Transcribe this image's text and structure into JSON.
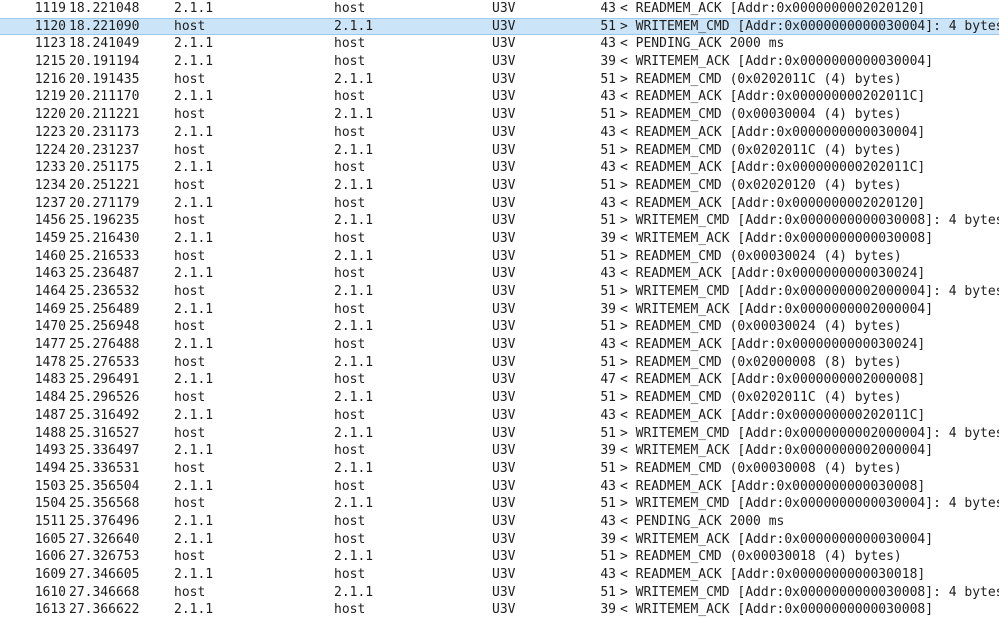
{
  "packets": [
    {
      "no": "1119",
      "time": "18.221048",
      "src": "2.1.1",
      "dst": "host",
      "proto": "U3V",
      "len": "43",
      "info": "< READMEM_ACK [Addr:0x0000000002020120]",
      "selected": false
    },
    {
      "no": "1120",
      "time": "18.221090",
      "src": "host",
      "dst": "2.1.1",
      "proto": "U3V",
      "len": "51",
      "info": "> WRITEMEM_CMD [Addr:0x0000000000030004]: 4 bytes",
      "selected": true
    },
    {
      "no": "1123",
      "time": "18.241049",
      "src": "2.1.1",
      "dst": "host",
      "proto": "U3V",
      "len": "43",
      "info": "< PENDING_ACK  2000 ms",
      "selected": false
    },
    {
      "no": "1215",
      "time": "20.191194",
      "src": "2.1.1",
      "dst": "host",
      "proto": "U3V",
      "len": "39",
      "info": "< WRITEMEM_ACK [Addr:0x0000000000030004]",
      "selected": false
    },
    {
      "no": "1216",
      "time": "20.191435",
      "src": "host",
      "dst": "2.1.1",
      "proto": "U3V",
      "len": "51",
      "info": "> READMEM_CMD  (0x0202011C (4) bytes)",
      "selected": false
    },
    {
      "no": "1219",
      "time": "20.211170",
      "src": "2.1.1",
      "dst": "host",
      "proto": "U3V",
      "len": "43",
      "info": "< READMEM_ACK [Addr:0x000000000202011C]",
      "selected": false
    },
    {
      "no": "1220",
      "time": "20.211221",
      "src": "host",
      "dst": "2.1.1",
      "proto": "U3V",
      "len": "51",
      "info": "> READMEM_CMD  (0x00030004 (4) bytes)",
      "selected": false
    },
    {
      "no": "1223",
      "time": "20.231173",
      "src": "2.1.1",
      "dst": "host",
      "proto": "U3V",
      "len": "43",
      "info": "< READMEM_ACK [Addr:0x0000000000030004]",
      "selected": false
    },
    {
      "no": "1224",
      "time": "20.231237",
      "src": "host",
      "dst": "2.1.1",
      "proto": "U3V",
      "len": "51",
      "info": "> READMEM_CMD  (0x0202011C (4) bytes)",
      "selected": false
    },
    {
      "no": "1233",
      "time": "20.251175",
      "src": "2.1.1",
      "dst": "host",
      "proto": "U3V",
      "len": "43",
      "info": "< READMEM_ACK [Addr:0x000000000202011C]",
      "selected": false
    },
    {
      "no": "1234",
      "time": "20.251221",
      "src": "host",
      "dst": "2.1.1",
      "proto": "U3V",
      "len": "51",
      "info": "> READMEM_CMD  (0x02020120 (4) bytes)",
      "selected": false
    },
    {
      "no": "1237",
      "time": "20.271179",
      "src": "2.1.1",
      "dst": "host",
      "proto": "U3V",
      "len": "43",
      "info": "< READMEM_ACK [Addr:0x0000000002020120]",
      "selected": false
    },
    {
      "no": "1456",
      "time": "25.196235",
      "src": "host",
      "dst": "2.1.1",
      "proto": "U3V",
      "len": "51",
      "info": "> WRITEMEM_CMD [Addr:0x0000000000030008]: 4 bytes",
      "selected": false
    },
    {
      "no": "1459",
      "time": "25.216430",
      "src": "2.1.1",
      "dst": "host",
      "proto": "U3V",
      "len": "39",
      "info": "< WRITEMEM_ACK [Addr:0x0000000000030008]",
      "selected": false
    },
    {
      "no": "1460",
      "time": "25.216533",
      "src": "host",
      "dst": "2.1.1",
      "proto": "U3V",
      "len": "51",
      "info": "> READMEM_CMD  (0x00030024 (4) bytes)",
      "selected": false
    },
    {
      "no": "1463",
      "time": "25.236487",
      "src": "2.1.1",
      "dst": "host",
      "proto": "U3V",
      "len": "43",
      "info": "< READMEM_ACK [Addr:0x0000000000030024]",
      "selected": false
    },
    {
      "no": "1464",
      "time": "25.236532",
      "src": "host",
      "dst": "2.1.1",
      "proto": "U3V",
      "len": "51",
      "info": "> WRITEMEM_CMD [Addr:0x0000000002000004]: 4 bytes",
      "selected": false
    },
    {
      "no": "1469",
      "time": "25.256489",
      "src": "2.1.1",
      "dst": "host",
      "proto": "U3V",
      "len": "39",
      "info": "< WRITEMEM_ACK [Addr:0x0000000002000004]",
      "selected": false
    },
    {
      "no": "1470",
      "time": "25.256948",
      "src": "host",
      "dst": "2.1.1",
      "proto": "U3V",
      "len": "51",
      "info": "> READMEM_CMD  (0x00030024 (4) bytes)",
      "selected": false
    },
    {
      "no": "1477",
      "time": "25.276488",
      "src": "2.1.1",
      "dst": "host",
      "proto": "U3V",
      "len": "43",
      "info": "< READMEM_ACK [Addr:0x0000000000030024]",
      "selected": false
    },
    {
      "no": "1478",
      "time": "25.276533",
      "src": "host",
      "dst": "2.1.1",
      "proto": "U3V",
      "len": "51",
      "info": "> READMEM_CMD  (0x02000008 (8) bytes)",
      "selected": false
    },
    {
      "no": "1483",
      "time": "25.296491",
      "src": "2.1.1",
      "dst": "host",
      "proto": "U3V",
      "len": "47",
      "info": "< READMEM_ACK [Addr:0x0000000002000008]",
      "selected": false
    },
    {
      "no": "1484",
      "time": "25.296526",
      "src": "host",
      "dst": "2.1.1",
      "proto": "U3V",
      "len": "51",
      "info": "> READMEM_CMD  (0x0202011C (4) bytes)",
      "selected": false
    },
    {
      "no": "1487",
      "time": "25.316492",
      "src": "2.1.1",
      "dst": "host",
      "proto": "U3V",
      "len": "43",
      "info": "< READMEM_ACK [Addr:0x000000000202011C]",
      "selected": false
    },
    {
      "no": "1488",
      "time": "25.316527",
      "src": "host",
      "dst": "2.1.1",
      "proto": "U3V",
      "len": "51",
      "info": "> WRITEMEM_CMD [Addr:0x0000000002000004]: 4 bytes",
      "selected": false
    },
    {
      "no": "1493",
      "time": "25.336497",
      "src": "2.1.1",
      "dst": "host",
      "proto": "U3V",
      "len": "39",
      "info": "< WRITEMEM_ACK [Addr:0x0000000002000004]",
      "selected": false
    },
    {
      "no": "1494",
      "time": "25.336531",
      "src": "host",
      "dst": "2.1.1",
      "proto": "U3V",
      "len": "51",
      "info": "> READMEM_CMD  (0x00030008 (4) bytes)",
      "selected": false
    },
    {
      "no": "1503",
      "time": "25.356504",
      "src": "2.1.1",
      "dst": "host",
      "proto": "U3V",
      "len": "43",
      "info": "< READMEM_ACK [Addr:0x0000000000030008]",
      "selected": false
    },
    {
      "no": "1504",
      "time": "25.356568",
      "src": "host",
      "dst": "2.1.1",
      "proto": "U3V",
      "len": "51",
      "info": "> WRITEMEM_CMD [Addr:0x0000000000030004]: 4 bytes",
      "selected": false
    },
    {
      "no": "1511",
      "time": "25.376496",
      "src": "2.1.1",
      "dst": "host",
      "proto": "U3V",
      "len": "43",
      "info": "< PENDING_ACK  2000 ms",
      "selected": false
    },
    {
      "no": "1605",
      "time": "27.326640",
      "src": "2.1.1",
      "dst": "host",
      "proto": "U3V",
      "len": "39",
      "info": "< WRITEMEM_ACK [Addr:0x0000000000030004]",
      "selected": false
    },
    {
      "no": "1606",
      "time": "27.326753",
      "src": "host",
      "dst": "2.1.1",
      "proto": "U3V",
      "len": "51",
      "info": "> READMEM_CMD  (0x00030018 (4) bytes)",
      "selected": false
    },
    {
      "no": "1609",
      "time": "27.346605",
      "src": "2.1.1",
      "dst": "host",
      "proto": "U3V",
      "len": "43",
      "info": "< READMEM_ACK [Addr:0x0000000000030018]",
      "selected": false
    },
    {
      "no": "1610",
      "time": "27.346668",
      "src": "host",
      "dst": "2.1.1",
      "proto": "U3V",
      "len": "51",
      "info": "> WRITEMEM_CMD [Addr:0x0000000000030008]: 4 bytes",
      "selected": false
    },
    {
      "no": "1613",
      "time": "27.366622",
      "src": "2.1.1",
      "dst": "host",
      "proto": "U3V",
      "len": "39",
      "info": "< WRITEMEM_ACK [Addr:0x0000000000030008]",
      "selected": false
    }
  ]
}
